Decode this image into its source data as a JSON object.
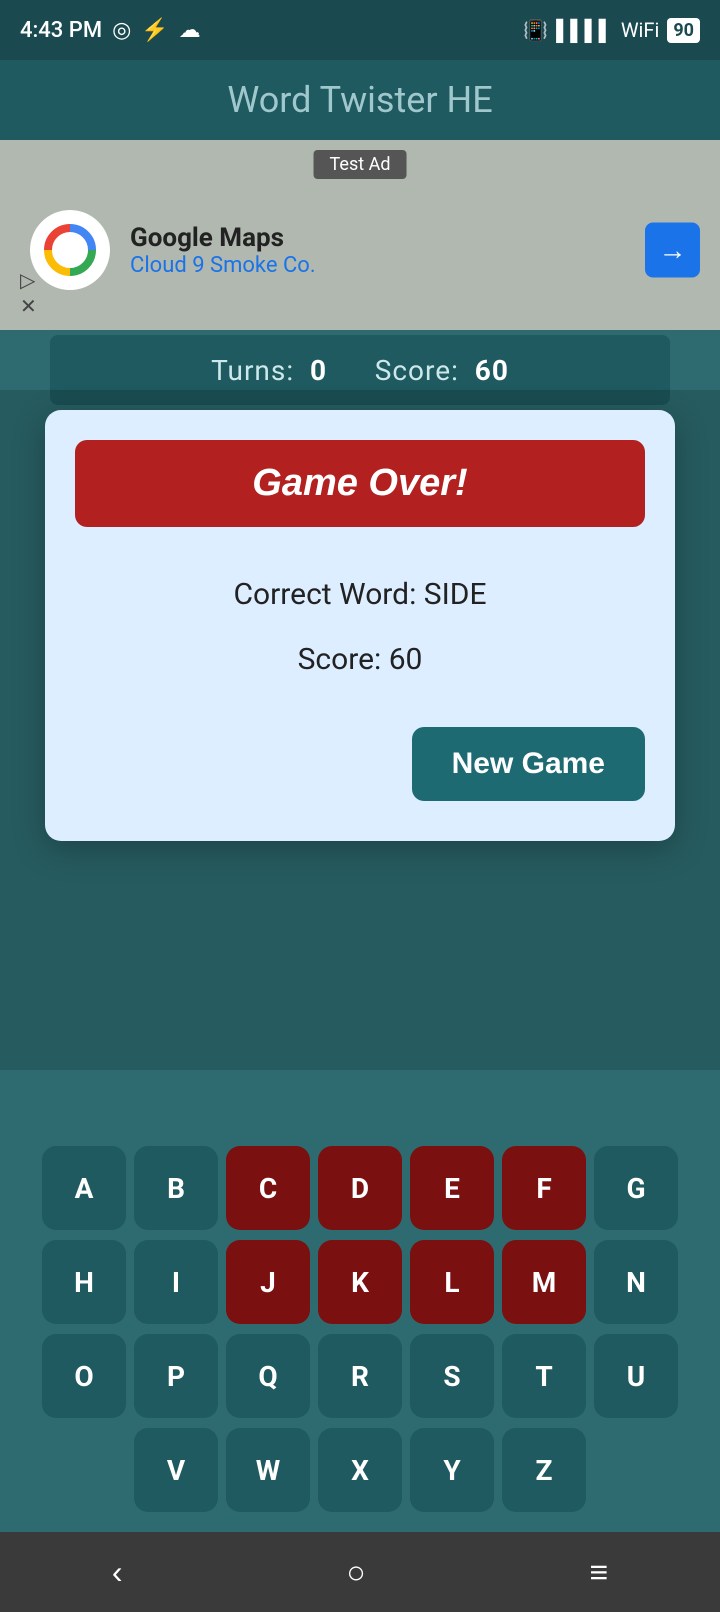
{
  "statusBar": {
    "time": "4:43 PM",
    "battery": "90"
  },
  "appTitle": "Word Twister HE",
  "ad": {
    "label": "Test Ad",
    "company": "Google Maps",
    "subtitle": "Cloud 9 Smoke Co."
  },
  "scoreBar": {
    "turnsLabel": "Turns:",
    "turnsValue": "0",
    "scoreLabel": "Score:",
    "scoreValue": "60"
  },
  "modal": {
    "gameOverLabel": "Game Over!",
    "correctWordLabel": "Correct Word: SIDE",
    "scoreLabel": "Score: 60",
    "newGameLabel": "New Game"
  },
  "keyboard": {
    "row1": [
      "A",
      "B",
      "C",
      "D",
      "E",
      "F",
      "G"
    ],
    "row2": [
      "H",
      "I",
      "J",
      "K",
      "L",
      "M",
      "N"
    ],
    "row3": [
      "O",
      "P",
      "Q",
      "R",
      "S",
      "T",
      "U"
    ],
    "row4": [
      "V",
      "W",
      "X",
      "Y",
      "Z"
    ],
    "usedDark": [
      "C",
      "D",
      "E",
      "F",
      "J",
      "K",
      "L",
      "M"
    ]
  },
  "nav": {
    "back": "‹",
    "home": "○",
    "menu": "≡"
  }
}
